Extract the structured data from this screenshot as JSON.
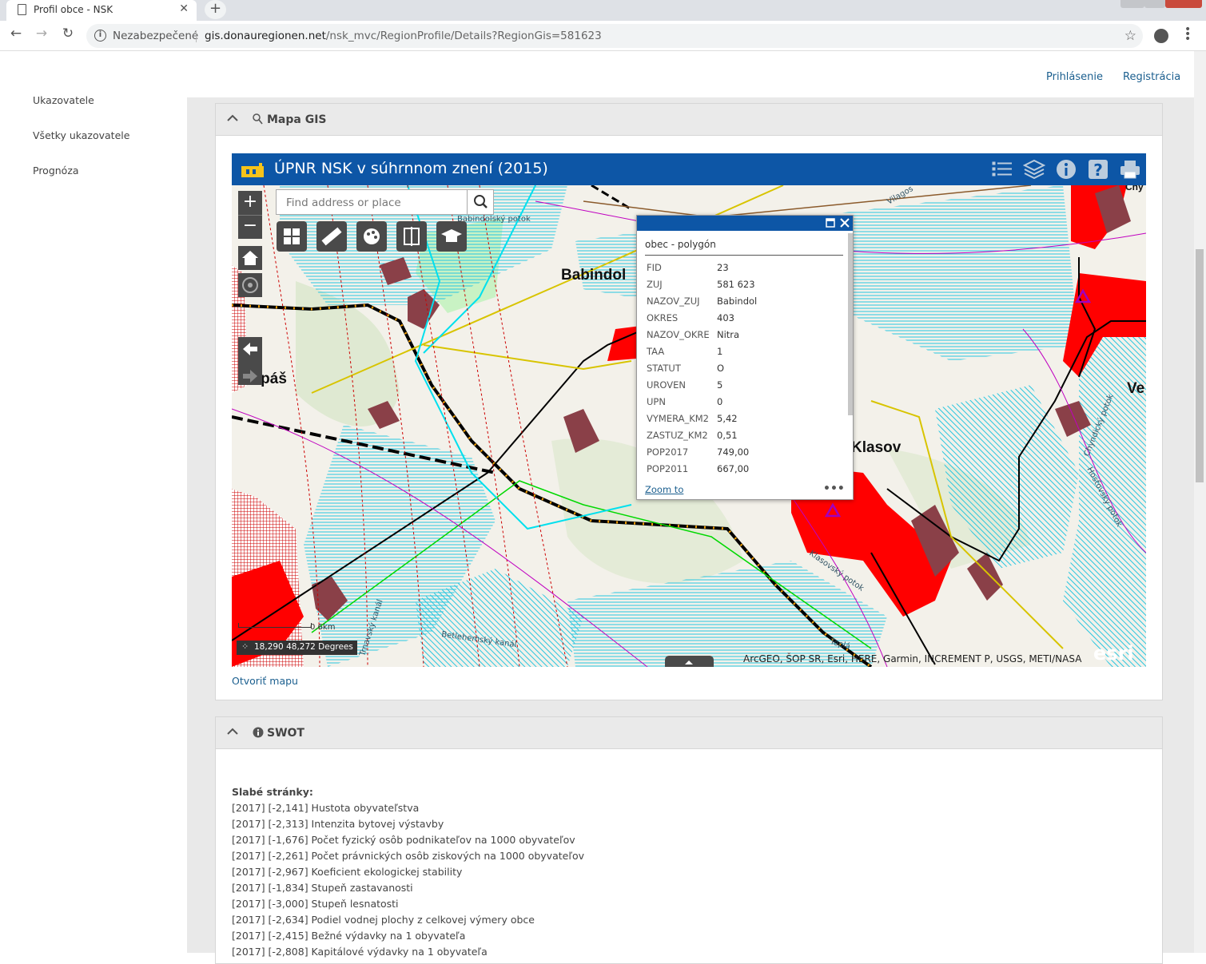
{
  "browser": {
    "tab_title": "Profil obce - NSK",
    "security_label": "Nezabezpečené",
    "url_host": "gis.donauregionen.net",
    "url_path": "/nsk_mvc/RegionProfile/Details?RegionGis=581623"
  },
  "header": {
    "login": "Prihlásenie",
    "register": "Registrácia"
  },
  "sidebar": {
    "items": [
      {
        "label": "Ukazovatele"
      },
      {
        "label": "Všetky ukazovatele"
      },
      {
        "label": "Prognóza"
      }
    ]
  },
  "map_panel": {
    "title": "Mapa GIS",
    "map_title": "ÚPNR NSK v súhrnnom znení (2015)",
    "search_placeholder": "Find address or place",
    "open_map_link": "Otvoriť mapu",
    "attribution": "ArcGEO, ŠOP SR, Esri, HERE, Garmin, INCREMENT P, USGS, METI/NASA",
    "esri_logo": "esri",
    "coordinates": "18,290 48,272 Degrees",
    "scale_label": "0.6km",
    "place_labels": {
      "babindol": "Babindol",
      "lapas": "Lapáš",
      "klasov": "Klasov",
      "ve": "Ve",
      "chy": "Chy",
      "babindolsky_potok": "Babindolský potok",
      "klasovsky_potok": "Klasovský potok",
      "chyndicky_potok": "Chyndický potok",
      "hostovsky_potok": "Hosťovský potok",
      "betlehemsky_kanal": "Betlehemský kanál",
      "teplа": "Teplá",
      "trnavsky_kanal": "Trnavský kanál",
      "vilagos": "Vilagos"
    },
    "popup": {
      "title": "obec - polygón",
      "zoom_to": "Zoom to",
      "more": "•••",
      "rows": [
        {
          "key": "FID",
          "value": "23"
        },
        {
          "key": "ZUJ",
          "value": "581 623"
        },
        {
          "key": "NAZOV_ZUJ",
          "value": "Babindol"
        },
        {
          "key": "OKRES",
          "value": "403"
        },
        {
          "key": "NAZOV_OKRE",
          "value": "Nitra"
        },
        {
          "key": "TAA",
          "value": "1"
        },
        {
          "key": "STATUT",
          "value": "O"
        },
        {
          "key": "UROVEN",
          "value": "5"
        },
        {
          "key": "UPN",
          "value": "0"
        },
        {
          "key": "VYMERA_KM2",
          "value": "5,42"
        },
        {
          "key": "ZASTUZ_KM2",
          "value": "0,51"
        },
        {
          "key": "POP2017",
          "value": "749,00"
        },
        {
          "key": "POP2011",
          "value": "667,00"
        }
      ]
    }
  },
  "swot_panel": {
    "title": "SWOT",
    "weak_heading": "Slabé stránky:",
    "items": [
      "[2017] [-2,141] Hustota obyvateľstva",
      "[2017] [-2,313] Intenzita bytovej výstavby",
      "[2017] [-1,676] Počet fyzický osôb podnikateľov na 1000 obyvateľov",
      "[2017] [-2,261] Počet právnických osôb ziskových na 1000 obyvateľov",
      "[2017] [-2,967] Koeficient ekologickej stability",
      "[2017] [-1,834] Stupeň zastavanosti",
      "[2017] [-3,000] Stupeň lesnatosti",
      "[2017] [-2,634] Podiel vodnej plochy z celkovej výmery obce",
      "[2017] [-2,415] Bežné výdavky na 1 obyvateľa",
      "[2017] [-2,808] Kapitálové výdavky na 1 obyvateľa"
    ]
  },
  "colors": {
    "map_bar": "#0d56a6",
    "link": "#1b5f8f",
    "panel_header": "#eaeaea"
  }
}
